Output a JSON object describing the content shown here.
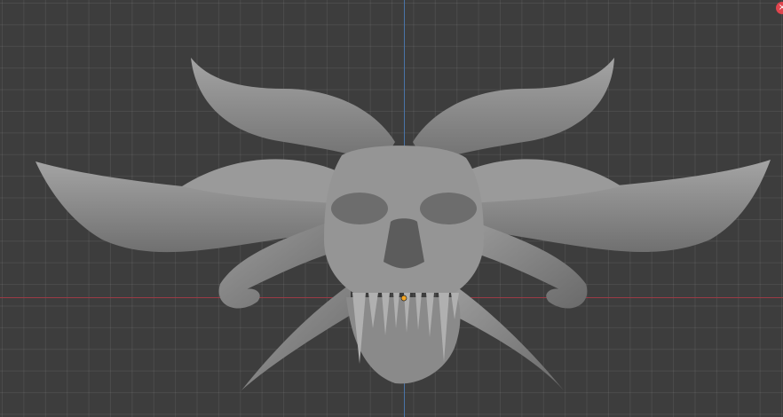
{
  "viewport": {
    "background": "#3d3d3d",
    "grid": true,
    "x_axis_color": "#9b3a45",
    "y_axis_color": "#4a74a8"
  },
  "model": {
    "kind": "sculpted dragon skull with horns",
    "material_color": "#8f8f8f",
    "origin_color": "#f5a623"
  },
  "close_icon": {
    "glyph": "×",
    "icon": "close-icon"
  }
}
